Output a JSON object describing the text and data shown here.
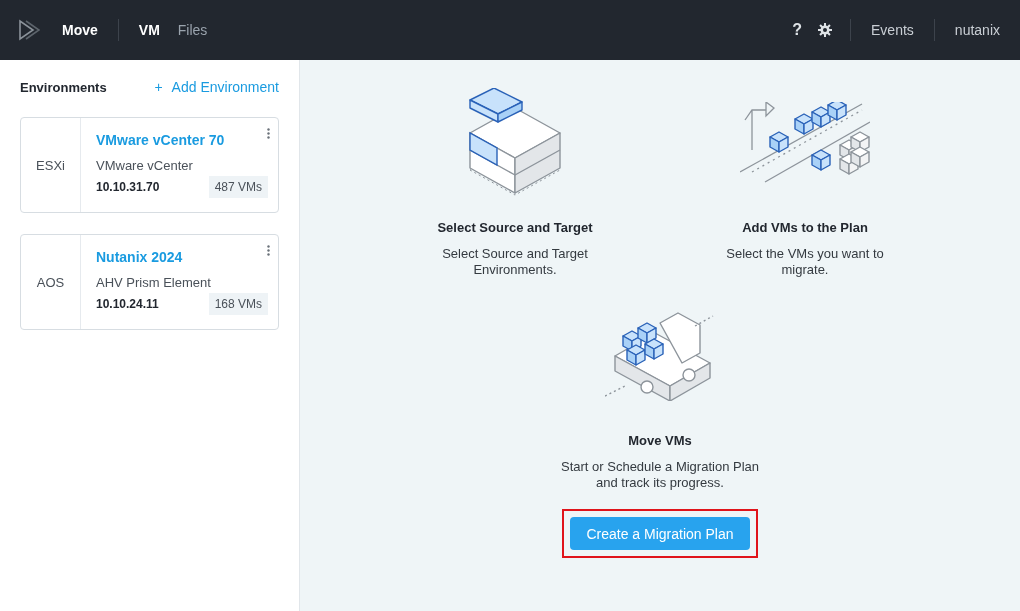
{
  "header": {
    "app_name": "Move",
    "tabs": [
      {
        "label": "VM",
        "selected": true
      },
      {
        "label": "Files",
        "selected": false
      }
    ],
    "help": "?",
    "events": "Events",
    "user": "nutanix"
  },
  "sidebar": {
    "title": "Environments",
    "add_link": "Add Environment",
    "add_icon": "+",
    "environments": [
      {
        "type": "ESXi",
        "name": "VMware vCenter 70",
        "product": "VMware vCenter",
        "address": "10.10.31.70",
        "vm_count": "487 VMs"
      },
      {
        "type": "AOS",
        "name": "Nutanix 2024",
        "product": "AHV Prism Element",
        "address": "10.10.24.11",
        "vm_count": "168 VMs"
      }
    ]
  },
  "steps": [
    {
      "kind": "servers",
      "title": "Select Source and Target",
      "description": "Select Source and Target Environments."
    },
    {
      "kind": "cubes",
      "title": "Add VMs to the Plan",
      "description": "Select the VMs you want to migrate."
    },
    {
      "kind": "truck",
      "title": "Move VMs",
      "description": "Start or Schedule a Migration Plan and track its progress."
    }
  ],
  "action": {
    "label": "Create a Migration Plan",
    "highlighted": true
  }
}
